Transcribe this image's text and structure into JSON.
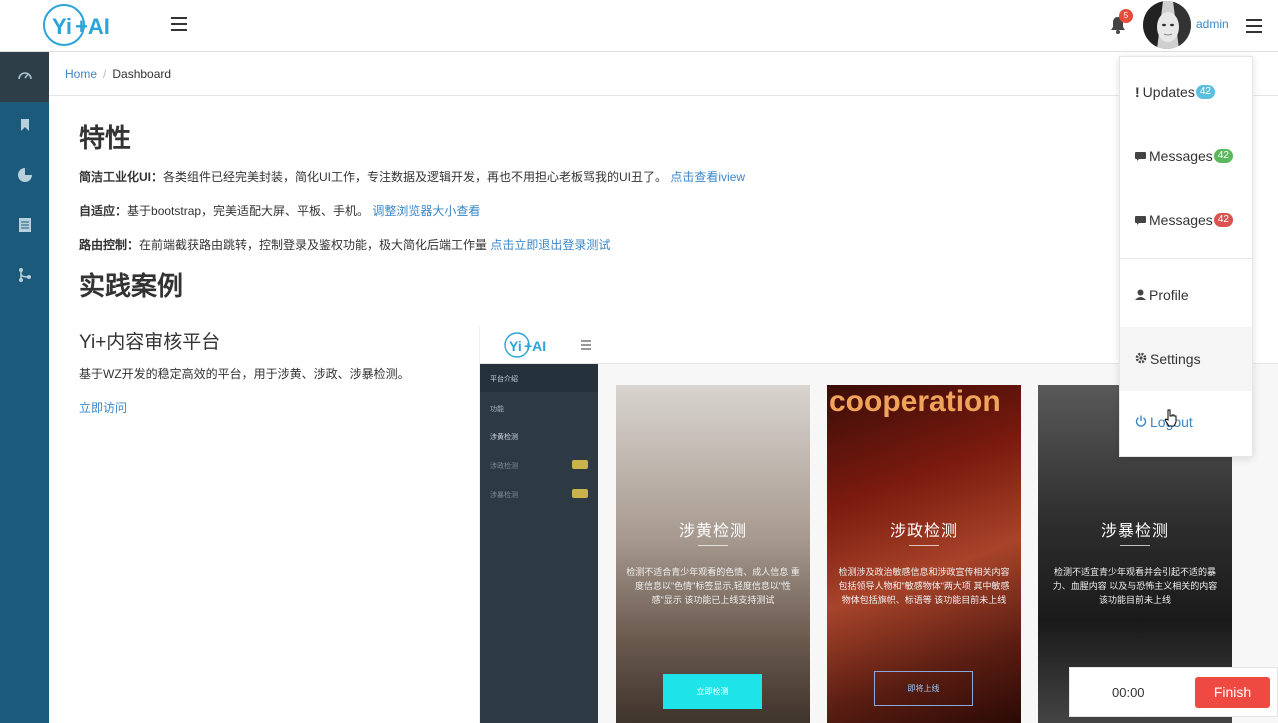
{
  "header": {
    "logo_text": "Yi+AI",
    "notification_count": "5",
    "username": "admin"
  },
  "breadcrumb": {
    "home": "Home",
    "separator": "/",
    "current": "Dashboard"
  },
  "features": {
    "title": "特性",
    "items": [
      {
        "label": "简洁工业化UI：",
        "text": "各类组件已经完美封装，简化UI工作，专注数据及逻辑开发，再也不用担心老板骂我的UI丑了。",
        "link": "点击查看iview"
      },
      {
        "label": "自适应：",
        "text": "基于bootstrap，完美适配大屏、平板、手机。",
        "link": "调整浏览器大小查看"
      },
      {
        "label": "路由控制：",
        "text": "在前端截获路由跳转，控制登录及鉴权功能，极大简化后端工作量",
        "link": "点击立即退出登录测试"
      }
    ]
  },
  "cases": {
    "title": "实践案例",
    "case_title": "Yi+内容审核平台",
    "case_desc": "基于WZ开发的稳定高效的平台，用于涉黄、涉政、涉暴检测。",
    "case_link": "立即访问"
  },
  "preview": {
    "logo_text": "Yi+AI",
    "sidebar": {
      "intro": "平台介绍",
      "section": "功能",
      "items": [
        "涉黄检测",
        "涉政检测",
        "涉暴检测"
      ]
    },
    "cards": [
      {
        "title": "涉黄检测",
        "text": "检测不适合青少年观看的色情、成人信息 重度信息以\"色情\"标签显示,轻度信息以\"性感\"显示 该功能已上线支持测试",
        "button": "立即检测"
      },
      {
        "title": "涉政检测",
        "text": "检测涉及政治敏感信息和涉政宣传相关内容 包括领导人物和\"敏感物体\"两大项 其中敏感物体包括旗帜、标语等 该功能目前未上线",
        "button": "即将上线"
      },
      {
        "title": "涉暴检测",
        "text": "检测不适宜青少年观看并会引起不适的暴力、血腥内容 以及与恐怖主义相关的内容 该功能目前未上线",
        "button": ""
      }
    ]
  },
  "dropdown": {
    "items": [
      {
        "label": "Updates",
        "badge": "42",
        "badge_color": "#5bc0de",
        "icon": "info-icon"
      },
      {
        "label": "Messages",
        "badge": "42",
        "badge_color": "#5cb85c",
        "icon": "comment-icon"
      },
      {
        "label": "Messages",
        "badge": "42",
        "badge_color": "#d9534f",
        "icon": "comment-icon"
      },
      {
        "label": "Profile",
        "icon": "user-icon"
      },
      {
        "label": "Settings",
        "icon": "gear-icon"
      },
      {
        "label": "Logout",
        "icon": "power-icon"
      }
    ]
  },
  "timer": {
    "time": "00:00",
    "finish_label": "Finish"
  }
}
